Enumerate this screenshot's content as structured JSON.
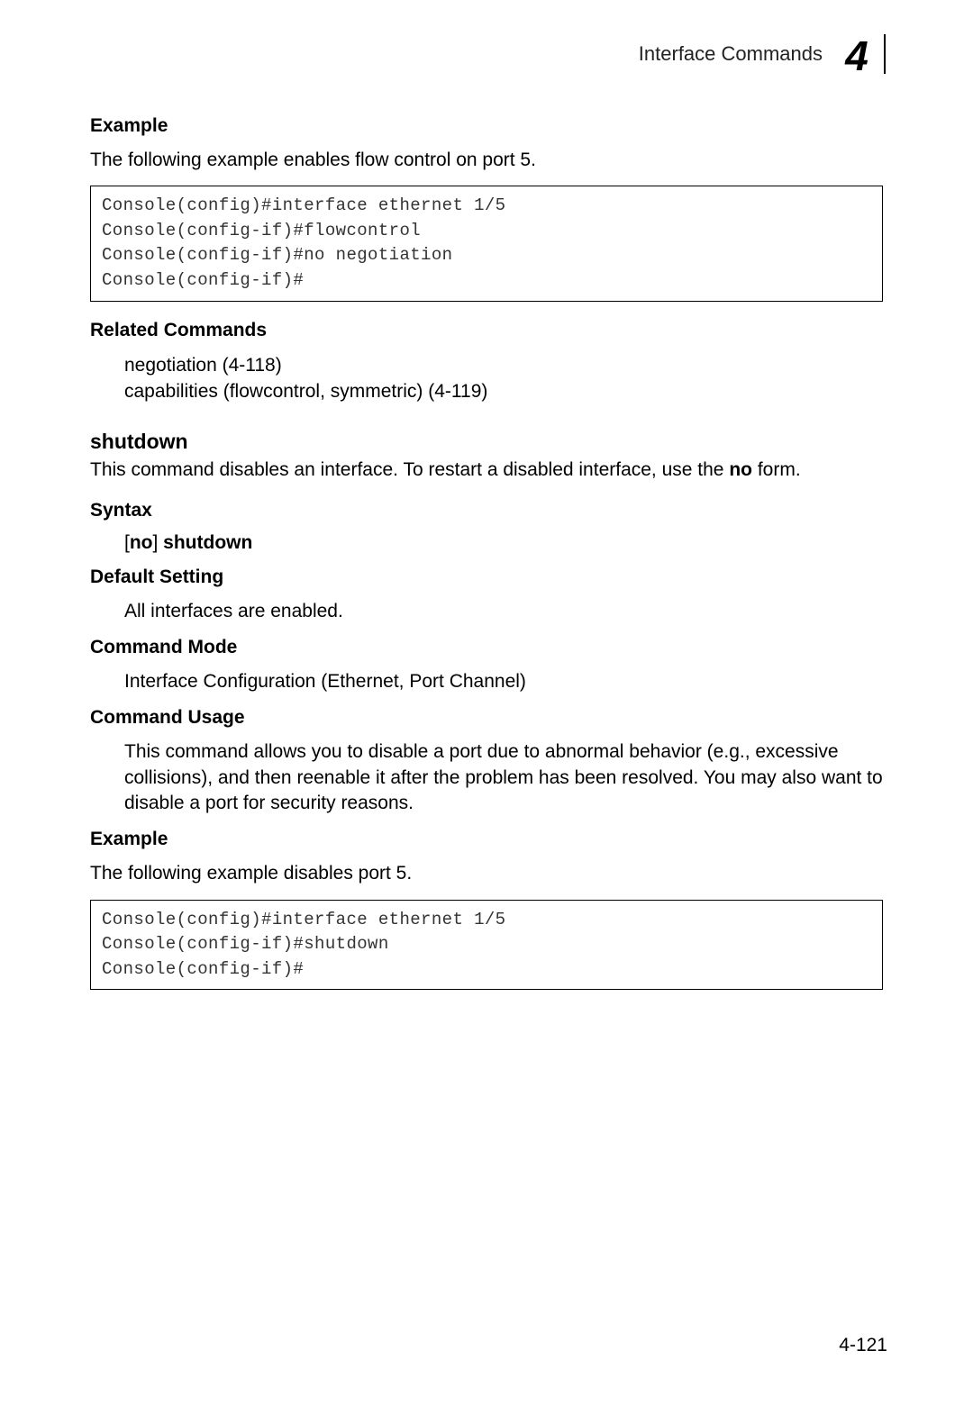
{
  "header": {
    "title": "Interface Commands",
    "chapter_number": "4"
  },
  "sections": {
    "example1": {
      "heading": "Example",
      "intro": "The following example enables flow control on port 5.",
      "code": "Console(config)#interface ethernet 1/5\nConsole(config-if)#flowcontrol\nConsole(config-if)#no negotiation\nConsole(config-if)#"
    },
    "related": {
      "heading": "Related Commands",
      "items": [
        "negotiation (4-118)",
        "capabilities (flowcontrol, symmetric) (4-119)"
      ]
    },
    "shutdown": {
      "title": "shutdown",
      "desc_pre": "This command disables an interface. To restart a disabled interface, use the ",
      "desc_bold": "no",
      "desc_post": " form."
    },
    "syntax": {
      "heading": "Syntax",
      "bracket_open": "[",
      "no": "no",
      "bracket_close": "]",
      "cmd": " shutdown"
    },
    "default": {
      "heading": "Default Setting",
      "text": "All interfaces are enabled."
    },
    "mode": {
      "heading": "Command Mode",
      "text": "Interface Configuration (Ethernet, Port Channel)"
    },
    "usage": {
      "heading": "Command Usage",
      "text": "This command allows you to disable a port due to abnormal behavior (e.g., excessive collisions), and then reenable it after the problem has been resolved. You may also want to disable a port for security reasons."
    },
    "example2": {
      "heading": "Example",
      "intro": "The following example disables port 5.",
      "code": "Console(config)#interface ethernet 1/5\nConsole(config-if)#shutdown\nConsole(config-if)#"
    }
  },
  "page_number": "4-121"
}
